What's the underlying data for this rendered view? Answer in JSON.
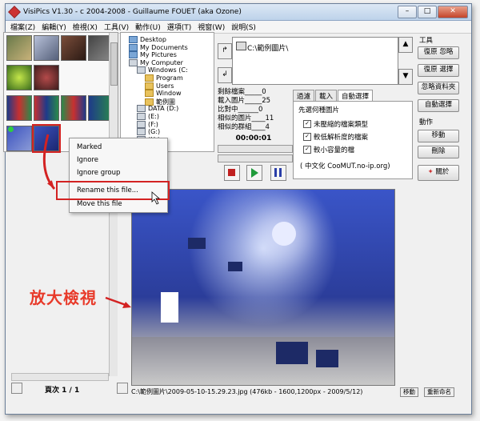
{
  "window": {
    "title": "VisiPics V1.30 - c 2004-2008 - Guillaume FOUET (aka Ozone)"
  },
  "menu": [
    "檔案(Z)",
    "編輯(Y)",
    "檢視(X)",
    "工具(V)",
    "動作(U)",
    "選項(T)",
    "視窗(W)",
    "說明(S)"
  ],
  "folders": [
    {
      "label": "Desktop",
      "kind": "blue"
    },
    {
      "label": "My Documents",
      "kind": "blue"
    },
    {
      "label": "My Pictures",
      "kind": "blue"
    },
    {
      "label": "My Computer",
      "kind": "drive"
    },
    {
      "label": "Windows (C:",
      "kind": "drive"
    },
    {
      "label": "Program",
      "kind": "folder"
    },
    {
      "label": "Users",
      "kind": "folder"
    },
    {
      "label": "Window",
      "kind": "folder"
    },
    {
      "label": "範例圖",
      "kind": "folder"
    },
    {
      "label": "DATA (D:)",
      "kind": "drive"
    },
    {
      "label": "(E:)",
      "kind": "drive"
    },
    {
      "label": "(F:)",
      "kind": "drive"
    },
    {
      "label": "(G:)",
      "kind": "drive"
    },
    {
      "label": "(H:)",
      "kind": "drive"
    },
    {
      "label": "(I:)",
      "kind": "drive"
    }
  ],
  "path": {
    "text": "C:\\範例圖片\\"
  },
  "stats": [
    "剩餘檔案_____0",
    "載入圖片_____25",
    "比對中______0",
    "相似的圖片____11",
    "相似的群組____4"
  ],
  "timer": "00:00:01",
  "tabs": [
    "過濾",
    "載入",
    "自動選擇"
  ],
  "autoselect": {
    "heading": "先選何種圖片",
    "options": [
      "未壓縮的檔案類型",
      "較低解析度的檔案",
      "較小容量的檔"
    ],
    "note": "( 中文化 CooMUT.no-ip.org)"
  },
  "tools": {
    "title": "工具",
    "buttons": [
      "復原 忽略",
      "復原 選擇",
      "忽略資料夾",
      "自動選擇"
    ]
  },
  "actions": {
    "title": "動作",
    "buttons": [
      "移動",
      "刪除"
    ],
    "close": "關於"
  },
  "context_menu": [
    "Marked",
    "Ignore",
    "Ignore group",
    "Rename this file...",
    "Move this file"
  ],
  "page": "頁次 1 / 1",
  "file_status": "C:\\範例圖片\\2009-05-10-15.29.23.jpg (476kb - 1600,1200px - 2009/5/12)",
  "footer_buttons": [
    "移動",
    "重新命名"
  ],
  "annotation": "放大檢視",
  "colors": {
    "accent": "#d32222",
    "annotation": "#e83a2a"
  }
}
